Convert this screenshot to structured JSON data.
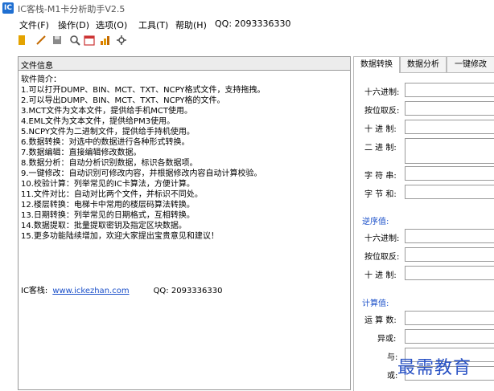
{
  "window": {
    "title": "IC客栈-M1卡分析助手V2.5",
    "icon": "app-logo-icon"
  },
  "menu": [
    "文件(F)",
    "操作(D)",
    "选项(O)",
    "工具(T)",
    "帮助(H)",
    "QQ:  2093336330"
  ],
  "toolbar": [
    {
      "name": "open-icon"
    },
    {
      "name": "edit-icon"
    },
    {
      "name": "save-icon"
    },
    {
      "name": "search-icon"
    },
    {
      "name": "calendar-icon"
    },
    {
      "name": "chart-icon"
    },
    {
      "name": "settings-icon"
    }
  ],
  "left_panel": {
    "header": "文件信息",
    "title": "软件简介：",
    "lines": [
      "1.可以打开DUMP、BIN、MCT、TXT、NCPY格式文件，支持拖拽。",
      "2.可以导出DUMP、BIN、MCT、TXT、NCPY格的文件。",
      "3.MCT文件为文本文件，提供给手机MCT使用。",
      "4.EML文件为文本文件，提供给PM3使用。",
      "5.NCPY文件为二进制文件，提供给手持机使用。",
      "6.数据转换：对选中的数据进行各种形式转换。",
      "7.数据编辑：直接编辑修改数据。",
      "8.数据分析：自动分析识别数据，标识各数据项。",
      "9.一键修改：自动识别可修改内容，并根据修改内容自动计算校验。",
      "10.校验计算：列举常见的IC卡算法，方便计算。",
      "11.文件对比：自动对比两个文件，并标识不同处。",
      "12.楼层转换：电梯卡中常用的楼层码算法转换。",
      "13.日期转换：列举常见的日期格式，互相转换。",
      "14.数据提取：批量提取密钥及指定区块数据。",
      "15.更多功能陆续增加，欢迎大家提出宝贵意见和建议！"
    ],
    "site_label": "IC客栈:",
    "site_link": "www.ickezhan.com",
    "qq": "QQ:  2093336330"
  },
  "right_panel": {
    "tabs": [
      "数据转换",
      "数据分析",
      "一键修改"
    ],
    "fields_top": [
      {
        "label": "十六进制:",
        "size": "normal"
      },
      {
        "label": "按位取反:",
        "size": "normal"
      },
      {
        "label": "十 进 制:",
        "size": "normal"
      },
      {
        "label": "二 进 制:",
        "size": "tall"
      },
      {
        "label": "字 符 串:",
        "size": "normal"
      },
      {
        "label": "字 节 和:",
        "size": "normal"
      }
    ],
    "reverse_title": "逆序值:",
    "fields_reverse": [
      {
        "label": "十六进制:"
      },
      {
        "label": "按位取反:"
      },
      {
        "label": "十 进 制:"
      }
    ],
    "calc_title": "计算值:",
    "fields_calc": [
      {
        "label": "运 算 数:"
      },
      {
        "label": "异或:"
      },
      {
        "label": "与:"
      },
      {
        "label": "或:"
      }
    ]
  },
  "watermark": "最需教育",
  "colors": {
    "accent": "#1a4fc9",
    "border": "#999999"
  }
}
